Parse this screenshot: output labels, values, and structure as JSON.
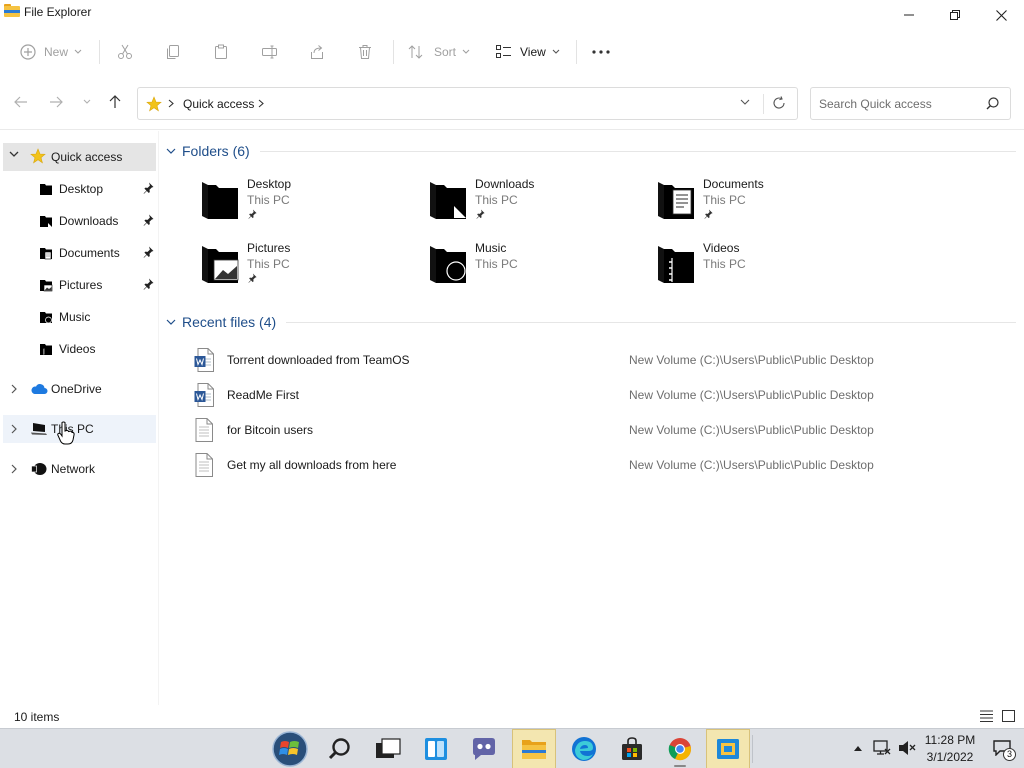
{
  "window": {
    "title": "File Explorer"
  },
  "toolbar": {
    "new_label": "New",
    "sort_label": "Sort",
    "view_label": "View"
  },
  "address": {
    "location": "Quick access",
    "search_placeholder": "Search Quick access"
  },
  "sidebar": {
    "quick_access": "Quick access",
    "items": [
      {
        "label": "Desktop",
        "icon": "desktop-icon",
        "pinned": true
      },
      {
        "label": "Downloads",
        "icon": "downloads-icon",
        "pinned": true
      },
      {
        "label": "Documents",
        "icon": "documents-icon",
        "pinned": true
      },
      {
        "label": "Pictures",
        "icon": "pictures-icon",
        "pinned": true
      },
      {
        "label": "Music",
        "icon": "music-icon",
        "pinned": false
      },
      {
        "label": "Videos",
        "icon": "videos-icon",
        "pinned": false
      }
    ],
    "onedrive": "OneDrive",
    "this_pc": "This PC",
    "network": "Network"
  },
  "folders": {
    "header": "Folders (6)",
    "items": [
      {
        "name": "Desktop",
        "location": "This PC",
        "pinned": true,
        "icon": "desktop-folder-icon"
      },
      {
        "name": "Downloads",
        "location": "This PC",
        "pinned": true,
        "icon": "downloads-folder-icon"
      },
      {
        "name": "Documents",
        "location": "This PC",
        "pinned": true,
        "icon": "documents-folder-icon"
      },
      {
        "name": "Pictures",
        "location": "This PC",
        "pinned": true,
        "icon": "pictures-folder-icon"
      },
      {
        "name": "Music",
        "location": "This PC",
        "pinned": false,
        "icon": "music-folder-icon"
      },
      {
        "name": "Videos",
        "location": "This PC",
        "pinned": false,
        "icon": "videos-folder-icon"
      }
    ]
  },
  "recent": {
    "header": "Recent files (4)",
    "items": [
      {
        "name": "Torrent downloaded from TeamOS",
        "path": "New Volume (C:)\\Users\\Public\\Public Desktop",
        "type": "word"
      },
      {
        "name": "ReadMe First",
        "path": "New Volume (C:)\\Users\\Public\\Public Desktop",
        "type": "word"
      },
      {
        "name": "for Bitcoin users",
        "path": "New Volume (C:)\\Users\\Public\\Public Desktop",
        "type": "text"
      },
      {
        "name": "Get my all downloads from here",
        "path": "New Volume (C:)\\Users\\Public\\Public Desktop",
        "type": "text"
      }
    ]
  },
  "status": {
    "item_count": "10 items"
  },
  "taskbar": {
    "time": "11:28 PM",
    "date": "3/1/2022",
    "notifications": "3"
  },
  "colors": {
    "accent": "#1f4e8a",
    "folder_star": "#f2c31a",
    "onedrive_blue": "#1e7ae0",
    "word_blue": "#2b5797"
  }
}
